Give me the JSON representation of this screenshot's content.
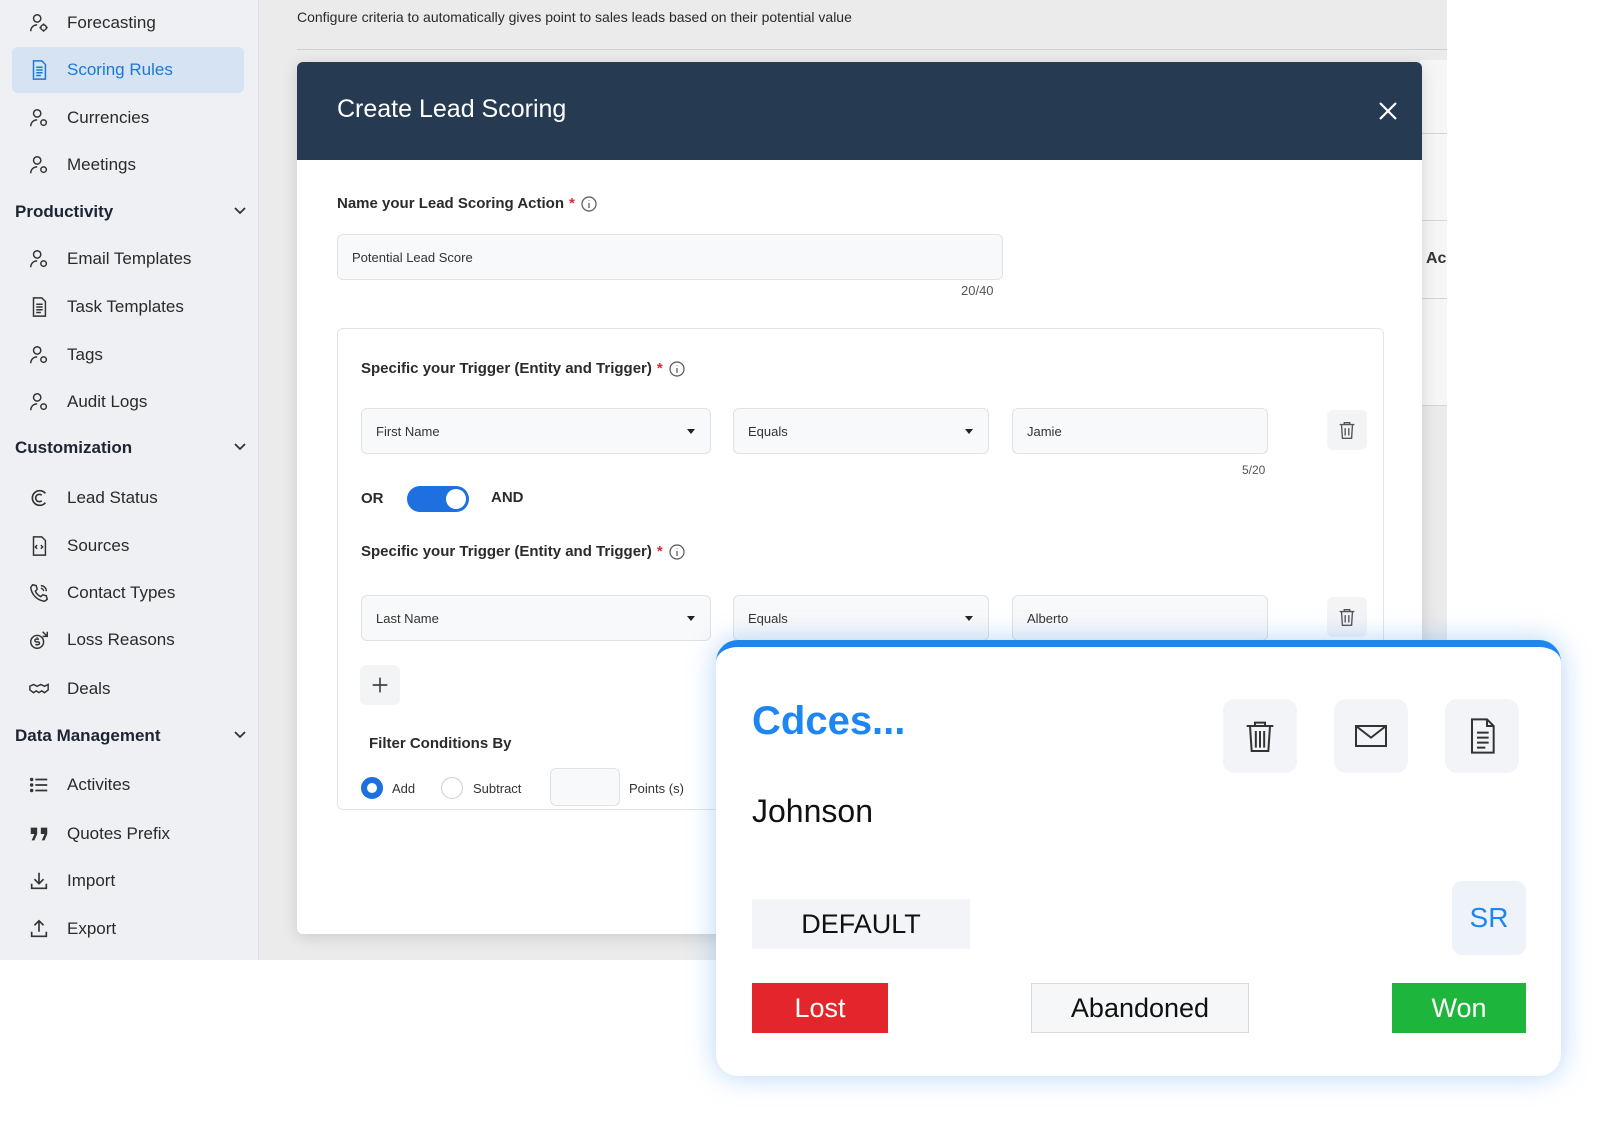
{
  "sidebar": {
    "items_top": [
      {
        "label": "Forecasting",
        "icon": "person-settings-icon"
      },
      {
        "label": "Scoring Rules",
        "icon": "document-icon",
        "active": true
      },
      {
        "label": "Currencies",
        "icon": "person-settings-icon"
      },
      {
        "label": "Meetings",
        "icon": "person-settings-icon"
      }
    ],
    "productivity": {
      "title": "Productivity",
      "items": [
        {
          "label": "Email Templates",
          "icon": "person-settings-icon"
        },
        {
          "label": "Task Templates",
          "icon": "document-icon"
        },
        {
          "label": "Tags",
          "icon": "person-settings-icon"
        },
        {
          "label": "Audit Logs",
          "icon": "person-settings-icon"
        }
      ]
    },
    "customization": {
      "title": "Customization",
      "items": [
        {
          "label": "Lead Status",
          "icon": "lead-status-icon"
        },
        {
          "label": "Sources",
          "icon": "code-document-icon"
        },
        {
          "label": "Contact Types",
          "icon": "phone-icon"
        },
        {
          "label": "Loss Reasons",
          "icon": "money-loss-icon"
        },
        {
          "label": "Deals",
          "icon": "handshake-icon"
        }
      ]
    },
    "data_management": {
      "title": "Data Management",
      "items": [
        {
          "label": "Activites",
          "icon": "list-icon"
        },
        {
          "label": "Quotes Prefix",
          "icon": "quote-icon"
        },
        {
          "label": "Import",
          "icon": "import-icon"
        },
        {
          "label": "Export",
          "icon": "export-icon"
        }
      ]
    }
  },
  "page": {
    "description": "Configure criteria to automatically gives point to sales leads based on their potential value",
    "background_column": "Ac"
  },
  "modal": {
    "title": "Create Lead Scoring",
    "name_label": "Name your Lead Scoring Action",
    "required_mark": "*",
    "name_value": "Potential Lead Score",
    "name_counter": "20/40",
    "trigger_label": "Specific your Trigger (Entity and Trigger)",
    "trigger1": {
      "field": "First Name",
      "operator": "Equals",
      "value": "Jamie",
      "counter": "5/20"
    },
    "logic": {
      "or_label": "OR",
      "and_label": "AND",
      "selected": "AND"
    },
    "trigger2": {
      "field": "Last Name",
      "operator": "Equals",
      "value": "Alberto"
    },
    "filter": {
      "label": "Filter Conditions By",
      "add_label": "Add",
      "subtract_label": "Subtract",
      "selected": "Add",
      "points_label": "Points (s)",
      "points_value": ""
    }
  },
  "card": {
    "title": "Cdces...",
    "name": "Johnson",
    "badge": "DEFAULT",
    "initials": "SR",
    "actions": [
      "trash-icon",
      "mail-icon",
      "document-icon"
    ],
    "statuses": [
      {
        "label": "Lost",
        "color": "#e3262b"
      },
      {
        "label": "Abandoned",
        "color": "#f6f7f8"
      },
      {
        "label": "Won",
        "color": "#1eb53c"
      }
    ]
  },
  "colors": {
    "accent": "#1e86f0",
    "header_bg": "#263a52",
    "toggle": "#1e6fe0",
    "active_nav_bg": "#d5e3f3",
    "required": "#e0263a"
  }
}
